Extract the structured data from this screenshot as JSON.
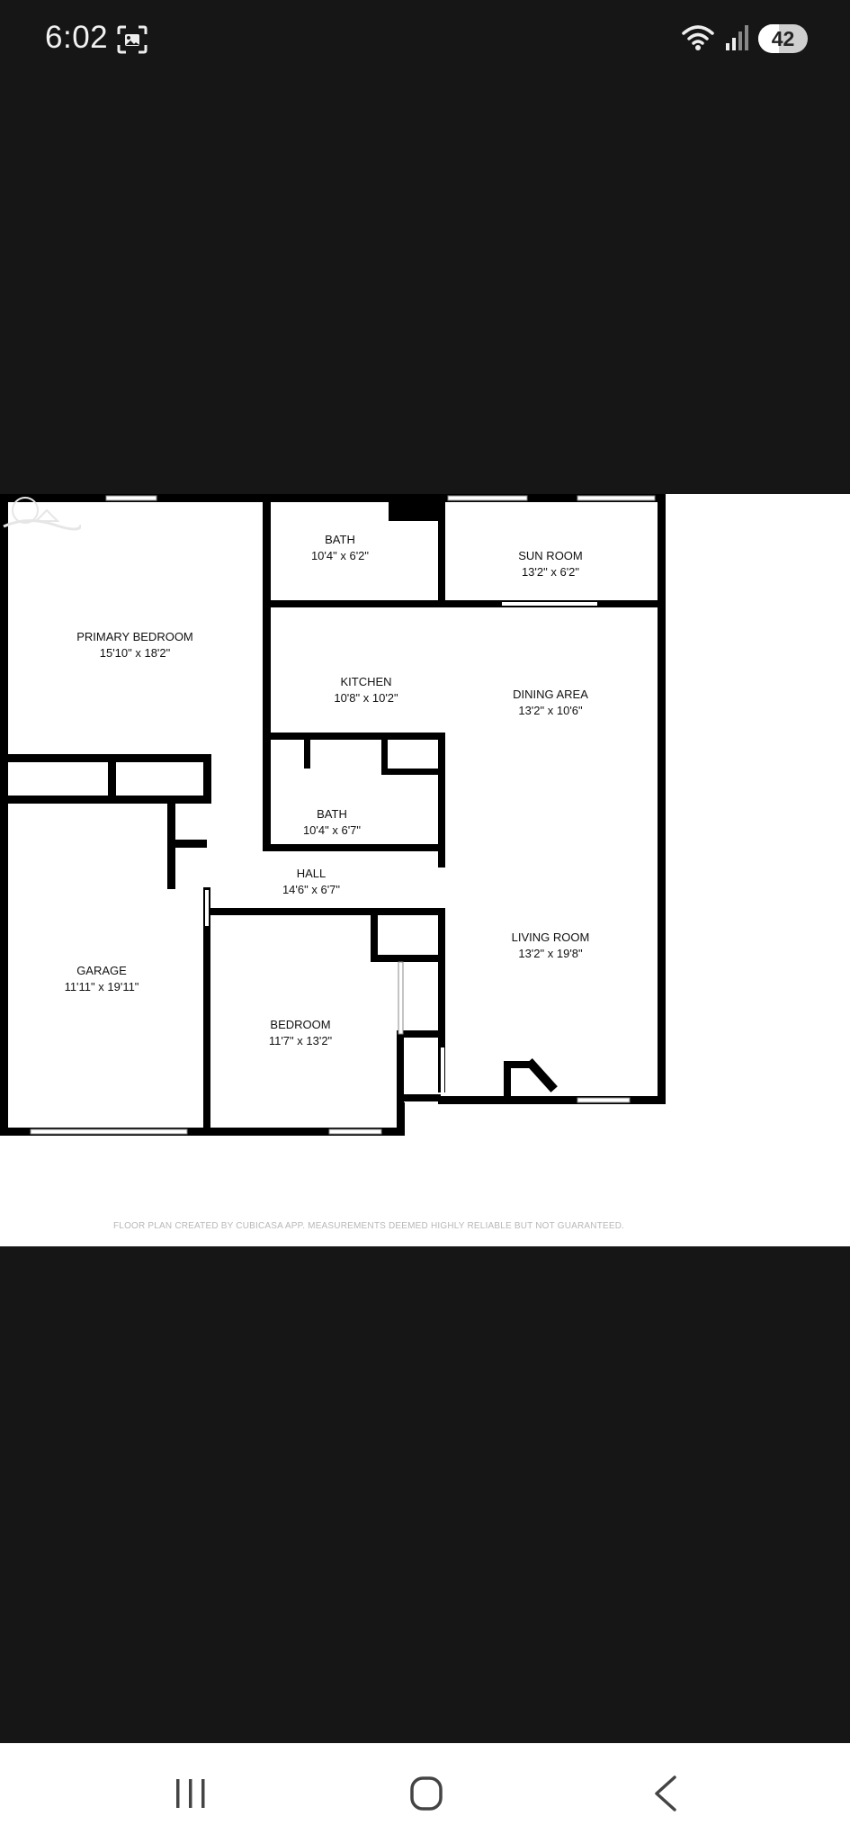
{
  "status_bar": {
    "time": "6:02",
    "battery_level": "42",
    "icons": [
      "screenshot-icon",
      "wifi-icon",
      "signal-icon",
      "battery-icon"
    ]
  },
  "floor_plan": {
    "rooms": [
      {
        "name": "BATH",
        "size": "10'4\" x 6'2\""
      },
      {
        "name": "SUN ROOM",
        "size": "13'2\" x 6'2\""
      },
      {
        "name": "PRIMARY BEDROOM",
        "size": "15'10\" x 18'2\""
      },
      {
        "name": "KITCHEN",
        "size": "10'8\" x 10'2\""
      },
      {
        "name": "DINING AREA",
        "size": "13'2\" x 10'6\""
      },
      {
        "name": "BATH",
        "size": "10'4\" x 6'7\""
      },
      {
        "name": "HALL",
        "size": "14'6\" x 6'7\""
      },
      {
        "name": "GARAGE",
        "size": "11'11\" x 19'11\""
      },
      {
        "name": "LIVING ROOM",
        "size": "13'2\" x 19'8\""
      },
      {
        "name": "BEDROOM",
        "size": "11'7\" x 13'2\""
      }
    ],
    "disclaimer": "FLOOR PLAN CREATED BY CUBICASA APP. MEASUREMENTS DEEMED HIGHLY RELIABLE BUT NOT GUARANTEED."
  },
  "nav_bar": {
    "buttons": [
      "recent-apps",
      "home",
      "back"
    ]
  }
}
